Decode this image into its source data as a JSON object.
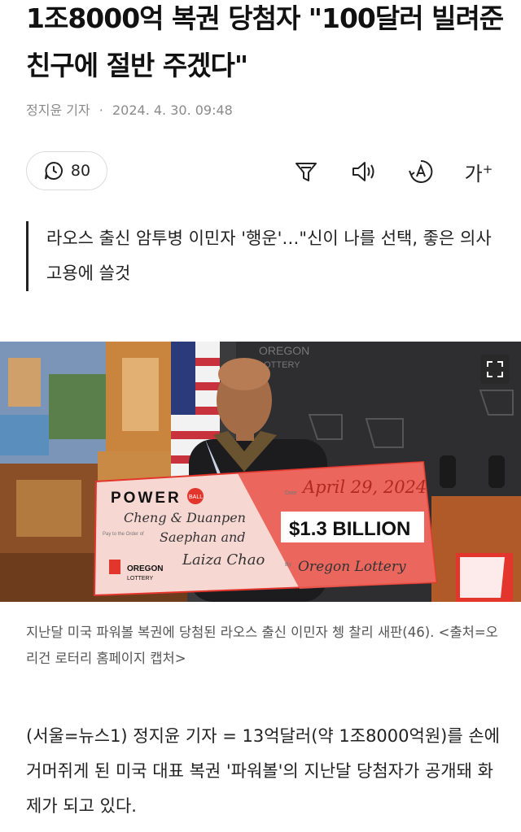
{
  "article": {
    "headline": "1조8000억 복권 당첨자 \"100달러 빌려준 친구에 절반 주겠다\"",
    "reporter": "정지윤 기자",
    "separator": "·",
    "date": "2024. 4. 30. 09:48",
    "comment_count": "80",
    "font_size_icon_label": "가",
    "subtitle": "라오스 출신 암투병 이민자 '행운'…\"신이 나를 선택, 좋은 의사 고용에 쓸것",
    "caption": "지난달 미국 파워볼 복권에 당첨된 라오스 출신 이민자 쳉 찰리 새판(46). <출처=오리건 로터리 홈페이지 캡처>",
    "body": "(서울=뉴스1) 정지윤 기자 = 13억달러(약 1조8000억원)를 손에 거머쥐게 된 미국 대표 복권 '파워볼'의 지난달 당첨자가 공개돼 화제가 되고 있다."
  },
  "photo": {
    "check_brand": "POWER",
    "check_brand_ball": "BALL",
    "check_date_label": "Date",
    "check_date": "April 29, 2024",
    "check_payee_line1": "Cheng & Duanpen",
    "check_payee_line2": "Saephan and",
    "check_payee_line3": "Laiza Chao",
    "check_amount": "$1.3 BILLION",
    "check_pay_label": "Pay to the Order of",
    "check_by_label": "By",
    "check_signature": "Oregon Lottery",
    "check_issuer_line1": "OREGON",
    "check_issuer_line2": "LOTTERY",
    "backdrop_line1": "OREGON",
    "backdrop_line2": "LOTTERY"
  },
  "colors": {
    "check_red": "#e2352c",
    "check_pink": "#f7d7d2",
    "text_dark": "#111111",
    "text_gray": "#8a8a8a"
  },
  "icons": [
    "clock-comment-icon",
    "filter-icon",
    "speaker-icon",
    "font-a-icon",
    "font-size-icon",
    "expand-icon"
  ]
}
